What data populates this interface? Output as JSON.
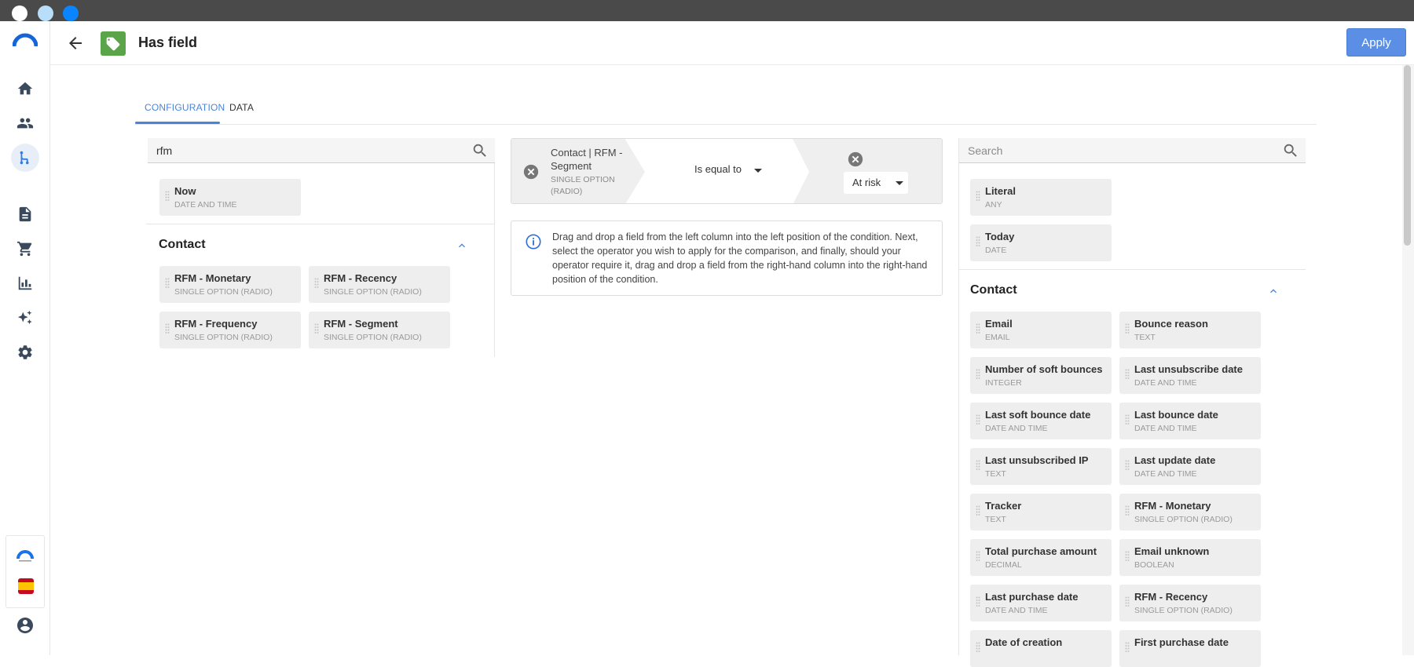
{
  "header": {
    "title": "Has field",
    "apply_label": "Apply"
  },
  "tabs": [
    {
      "label": "CONFIGURATION",
      "active": true
    },
    {
      "label": "DATA",
      "active": false
    }
  ],
  "sidebar": {
    "items": [
      {
        "icon": "home-icon"
      },
      {
        "icon": "contacts-icon"
      },
      {
        "icon": "flows-icon",
        "active": true
      },
      {
        "icon": "documents-icon"
      },
      {
        "icon": "cart-icon"
      },
      {
        "icon": "chart-icon"
      },
      {
        "icon": "sparkles-icon"
      },
      {
        "icon": "gear-icon"
      }
    ]
  },
  "left_panel": {
    "search_value": "rfm",
    "top_fields": [
      {
        "name": "Now",
        "type": "DATE AND TIME"
      }
    ],
    "section_title": "Contact",
    "fields": [
      {
        "name": "RFM - Monetary",
        "type": "SINGLE OPTION (RADIO)"
      },
      {
        "name": "RFM - Recency",
        "type": "SINGLE OPTION (RADIO)"
      },
      {
        "name": "RFM - Frequency",
        "type": "SINGLE OPTION (RADIO)"
      },
      {
        "name": "RFM - Segment",
        "type": "SINGLE OPTION (RADIO)"
      }
    ]
  },
  "condition": {
    "field_label": "Contact | RFM - Segment",
    "field_type": "SINGLE OPTION (RADIO)",
    "operator": "Is equal to",
    "value": "At risk"
  },
  "info": {
    "text": "Drag and drop a field from the left column into the left position of the condition. Next, select the operator you wish to apply for the comparison, and finally, should your operator require it, drag and drop a field from the right-hand column into the right-hand position of the condition."
  },
  "right_panel": {
    "search_placeholder": "Search",
    "top_fields": [
      {
        "name": "Literal",
        "type": "ANY"
      },
      {
        "name": "Today",
        "type": "DATE"
      }
    ],
    "section_title": "Contact",
    "fields": [
      {
        "name": "Email",
        "type": "EMAIL"
      },
      {
        "name": "Bounce reason",
        "type": "TEXT"
      },
      {
        "name": "Number of soft bounces",
        "type": "INTEGER"
      },
      {
        "name": "Last unsubscribe date",
        "type": "DATE AND TIME"
      },
      {
        "name": "Last soft bounce date",
        "type": "DATE AND TIME"
      },
      {
        "name": "Last bounce date",
        "type": "DATE AND TIME"
      },
      {
        "name": "Last unsubscribed IP",
        "type": "TEXT"
      },
      {
        "name": "Last update date",
        "type": "DATE AND TIME"
      },
      {
        "name": "Tracker",
        "type": "TEXT"
      },
      {
        "name": "RFM - Monetary",
        "type": "SINGLE OPTION (RADIO)"
      },
      {
        "name": "Total purchase amount",
        "type": "DECIMAL"
      },
      {
        "name": "Email unknown",
        "type": "BOOLEAN"
      },
      {
        "name": "Last purchase date",
        "type": "DATE AND TIME"
      },
      {
        "name": "RFM - Recency",
        "type": "SINGLE OPTION (RADIO)"
      },
      {
        "name": "Date of creation",
        "type": ""
      },
      {
        "name": "First purchase date",
        "type": ""
      }
    ]
  },
  "colors": {
    "accent": "#4a84d8",
    "apply_button": "#5b8fe6",
    "tag_badge": "#5aa44a",
    "chip_bg": "#eeeeef"
  }
}
